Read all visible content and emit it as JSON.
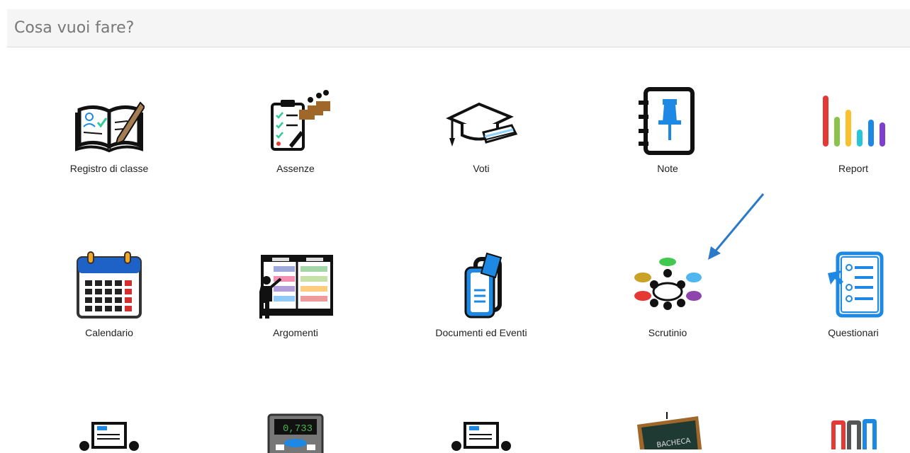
{
  "header": {
    "title": "Cosa vuoi fare?"
  },
  "tiles": [
    {
      "label": "Registro di classe",
      "icon": "open-register-book-icon"
    },
    {
      "label": "Assenze",
      "icon": "attendance-checklist-icon"
    },
    {
      "label": "Voti",
      "icon": "graduation-cap-grades-icon"
    },
    {
      "label": "Note",
      "icon": "notebook-pin-icon"
    },
    {
      "label": "Report",
      "icon": "colored-bars-report-icon"
    },
    {
      "label": "Calendario",
      "icon": "calendar-icon"
    },
    {
      "label": "Argomenti",
      "icon": "teacher-board-icon"
    },
    {
      "label": "Documenti ed Eventi",
      "icon": "document-event-icon"
    },
    {
      "label": "Scrutinio",
      "icon": "meeting-table-icon"
    },
    {
      "label": "Questionari",
      "icon": "questionnaire-icon"
    }
  ],
  "bottom_row_icons": [
    "scoreboard-meeting-icon",
    "calculator-icon",
    "scoreboard-meeting-icon",
    "chalkboard-icon",
    "binders-icon"
  ],
  "calculator_display": "0,733",
  "chalkboard_text": "BACHECA",
  "colors": {
    "header_bg": "#f5f5f5",
    "header_text": "#777777",
    "icon_blue": "#1e88e5",
    "arrow_blue": "#2b79c9"
  }
}
